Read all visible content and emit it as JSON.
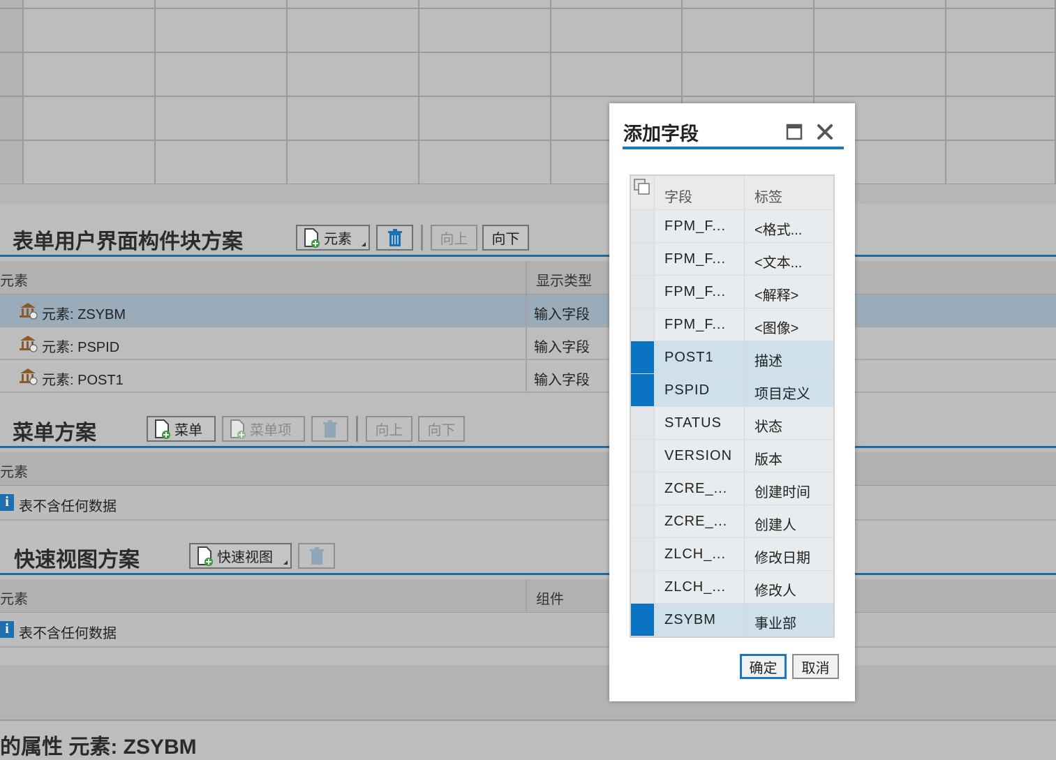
{
  "form_scheme": {
    "title": "表单用户界面构件块方案",
    "buttons": {
      "element": "元素",
      "up": "向上",
      "down": "向下"
    },
    "columns": [
      "元素",
      "显示类型"
    ],
    "rows": [
      {
        "element": "元素: ZSYBM",
        "display_type": "输入字段"
      },
      {
        "element": "元素: PSPID",
        "display_type": "输入字段"
      },
      {
        "element": "元素: POST1",
        "display_type": "输入字段"
      }
    ]
  },
  "menu_scheme": {
    "title": "菜单方案",
    "buttons": {
      "menu": "菜单",
      "menu_item": "菜单项",
      "up": "向上",
      "down": "向下"
    },
    "columns": [
      "元素"
    ],
    "empty_text": "表不含任何数据"
  },
  "quickview_scheme": {
    "title": "快速视图方案",
    "buttons": {
      "quickview": "快速视图"
    },
    "columns": [
      "元素",
      "组件"
    ],
    "empty_text": "表不含任何数据"
  },
  "properties_title": "的属性 元素: ZSYBM",
  "dialog": {
    "title": "添加字段",
    "columns": {
      "field": "字段",
      "label": "标签"
    },
    "rows": [
      {
        "field": "FPM_F...",
        "label": "<格式...",
        "selected": false
      },
      {
        "field": "FPM_F...",
        "label": "<文本...",
        "selected": false
      },
      {
        "field": "FPM_F...",
        "label": "<解释>",
        "selected": false
      },
      {
        "field": "FPM_F...",
        "label": "<图像>",
        "selected": false
      },
      {
        "field": "POST1",
        "label": "描述",
        "selected": true
      },
      {
        "field": "PSPID",
        "label": "项目定义",
        "selected": true
      },
      {
        "field": "STATUS",
        "label": "状态",
        "selected": false
      },
      {
        "field": "VERSION",
        "label": "版本",
        "selected": false
      },
      {
        "field": "ZCRE_...",
        "label": "创建时间",
        "selected": false
      },
      {
        "field": "ZCRE_...",
        "label": "创建人",
        "selected": false
      },
      {
        "field": "ZLCH_...",
        "label": "修改日期",
        "selected": false
      },
      {
        "field": "ZLCH_...",
        "label": "修改人",
        "selected": false
      },
      {
        "field": "ZSYBM",
        "label": "事业部",
        "selected": true
      }
    ],
    "ok": "确定",
    "cancel": "取消"
  },
  "colors": {
    "accent": "#1a78bf",
    "selection": "#0b74c2",
    "overlay": "#bdbdbd"
  }
}
